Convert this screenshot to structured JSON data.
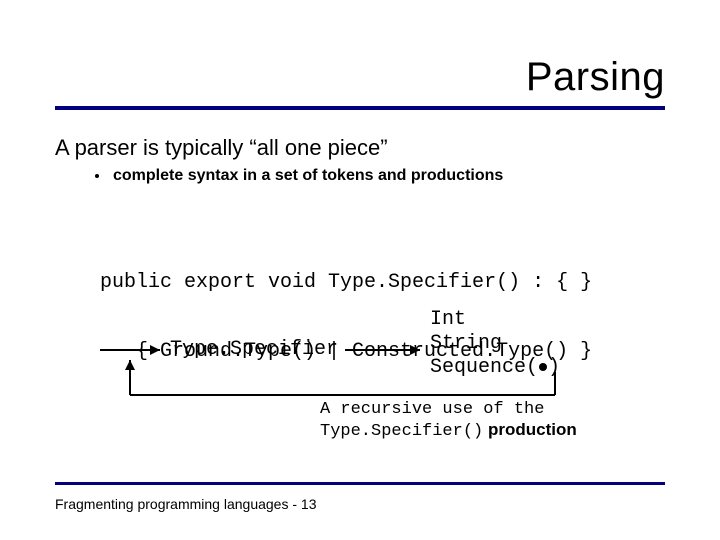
{
  "title": "Parsing",
  "lead": "A parser is typically “all one piece”",
  "bullet": "complete syntax in a set of tokens and productions",
  "code_line1": "public export void Type.Specifier() : { }",
  "code_line2": "   { Ground.Type() | Constructed.Type() }",
  "diagram": {
    "label": "Type.Specifier",
    "type1": "Int",
    "type2": "String",
    "type3_prefix": "Sequence(",
    "type3_suffix": ")"
  },
  "caption_line1": "A recursive use of the",
  "caption_code": "Type.Specifier()",
  "caption_line2_rest": " production",
  "footer": "Fragmenting programming languages  - 13"
}
